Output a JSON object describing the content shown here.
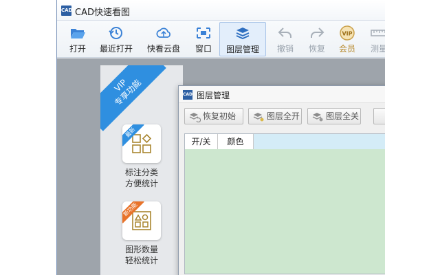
{
  "app": {
    "title": "CAD快速看图",
    "logo_text": "CAD"
  },
  "toolbar": {
    "items": [
      {
        "label": "打开",
        "icon": "folder-open-icon",
        "state": "normal"
      },
      {
        "label": "最近打开",
        "icon": "history-icon",
        "state": "normal"
      },
      {
        "label": "快看云盘",
        "icon": "cloud-icon",
        "state": "normal"
      },
      {
        "label": "窗口",
        "icon": "window-select-icon",
        "state": "normal"
      },
      {
        "label": "图层管理",
        "icon": "layers-icon",
        "state": "active"
      },
      {
        "label": "撤销",
        "icon": "undo-icon",
        "state": "disabled"
      },
      {
        "label": "恢复",
        "icon": "redo-icon",
        "state": "disabled"
      },
      {
        "label": "会员",
        "icon": "vip-badge-icon",
        "state": "vip"
      },
      {
        "label": "测量",
        "icon": "ruler-icon",
        "state": "disabled"
      }
    ],
    "vip_badge_text": "VIP"
  },
  "vip_panel": {
    "ribbon_line1": "VIP",
    "ribbon_line2": "专享功能",
    "features": [
      {
        "badge": "最新",
        "badge_color": "#2f8fe0",
        "line1": "标注分类",
        "line2": "方便统计",
        "icon": "category-grid-icon"
      },
      {
        "badge": "新功能",
        "badge_color": "#e8732a",
        "line1": "图形数量",
        "line2": "轻松统计",
        "icon": "shape-count-icon"
      }
    ]
  },
  "dialog": {
    "title": "图层管理",
    "logo_text": "CAD",
    "buttons": [
      {
        "label": "恢复初始",
        "icon": "restore-layers-icon"
      },
      {
        "label": "图层全开",
        "icon": "layers-on-icon"
      },
      {
        "label": "图层全关",
        "icon": "layers-off-icon"
      }
    ],
    "columns": [
      "开/关",
      "颜色"
    ]
  },
  "colors": {
    "accent_blue": "#2f8fe0",
    "grid_bg": "#cde7cf",
    "vip_gold": "#b7892b"
  }
}
